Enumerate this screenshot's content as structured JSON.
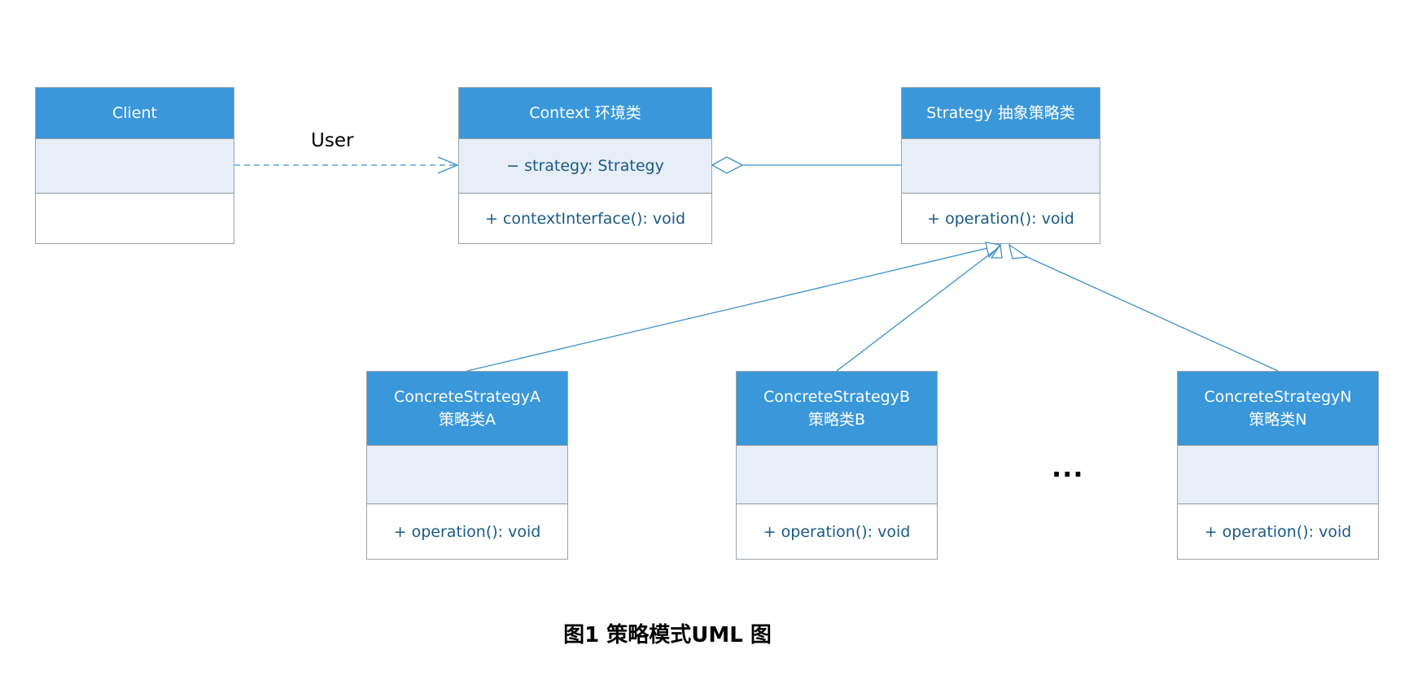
{
  "diagram": {
    "classes": {
      "client": {
        "name": "Client",
        "attributes": "",
        "operations": ""
      },
      "context": {
        "name": "Context 环境类",
        "attributes": "− strategy: Strategy",
        "operations": "+ contextInterface(): void"
      },
      "strategy": {
        "name": "Strategy 抽象策略类",
        "attributes": "",
        "operations": "+ operation(): void"
      },
      "concrete_a": {
        "name_line1": "ConcreteStrategyA",
        "name_line2": "策略类A",
        "attributes": "",
        "operations": "+ operation(): void"
      },
      "concrete_b": {
        "name_line1": "ConcreteStrategyB",
        "name_line2": "策略类B",
        "attributes": "",
        "operations": "+ operation(): void"
      },
      "concrete_n": {
        "name_line1": "ConcreteStrategyN",
        "name_line2": "策略类N",
        "attributes": "",
        "operations": "+ operation(): void"
      }
    },
    "relations": {
      "client_context_label": "User"
    },
    "ellipsis": "...",
    "caption": "图1 策略模式UML 图",
    "colors": {
      "header_fill": "#3a97da",
      "attribute_fill": "#e7eef7",
      "member_text": "#1a5a87",
      "connector": "#3a8fd0",
      "border": "#9aa4ad"
    }
  }
}
